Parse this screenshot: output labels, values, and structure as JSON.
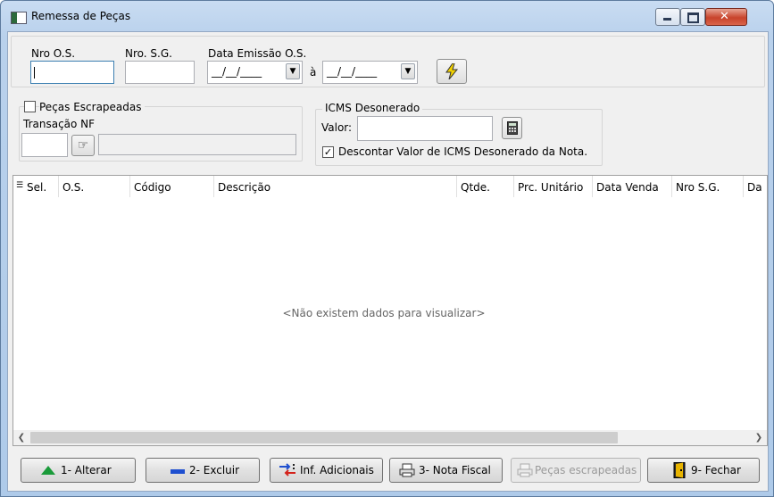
{
  "window": {
    "title": "Remessa de Peças"
  },
  "filters": {
    "nro_os_label": "Nro O.S.",
    "nro_sg_label": "Nro. S.G.",
    "data_emissao_label": "Data Emissão O.S.",
    "date_from": "__/__/____",
    "date_to": "__/__/____",
    "date_separator": "à"
  },
  "pecas": {
    "checkbox_label": "Peças Escrapeadas",
    "checked": false,
    "transacao_label": "Transação NF"
  },
  "icms": {
    "group_label": "ICMS Desonerado",
    "valor_label": "Valor:",
    "descontar_label": "Descontar Valor de ICMS Desonerado da Nota.",
    "descontar_checked": true
  },
  "grid": {
    "columns": [
      "Sel.",
      "O.S.",
      "Código",
      "Descrição",
      "Qtde.",
      "Prc. Unitário",
      "Data Venda",
      "Nro S.G.",
      "Da"
    ],
    "empty_message": "<Não existem dados para visualizar>"
  },
  "buttons": {
    "alterar": "1- Alterar",
    "excluir": "2- Excluir",
    "inf_adicionais": "Inf. Adicionais",
    "nota_fiscal": "3- Nota Fiscal",
    "pecas_escrapeadas": "Peças escrapeadas",
    "fechar": "9- Fechar"
  },
  "colors": {
    "accent_green": "#1a9b3a",
    "accent_blue": "#1e4fd0",
    "lightning": "#f3d200"
  }
}
